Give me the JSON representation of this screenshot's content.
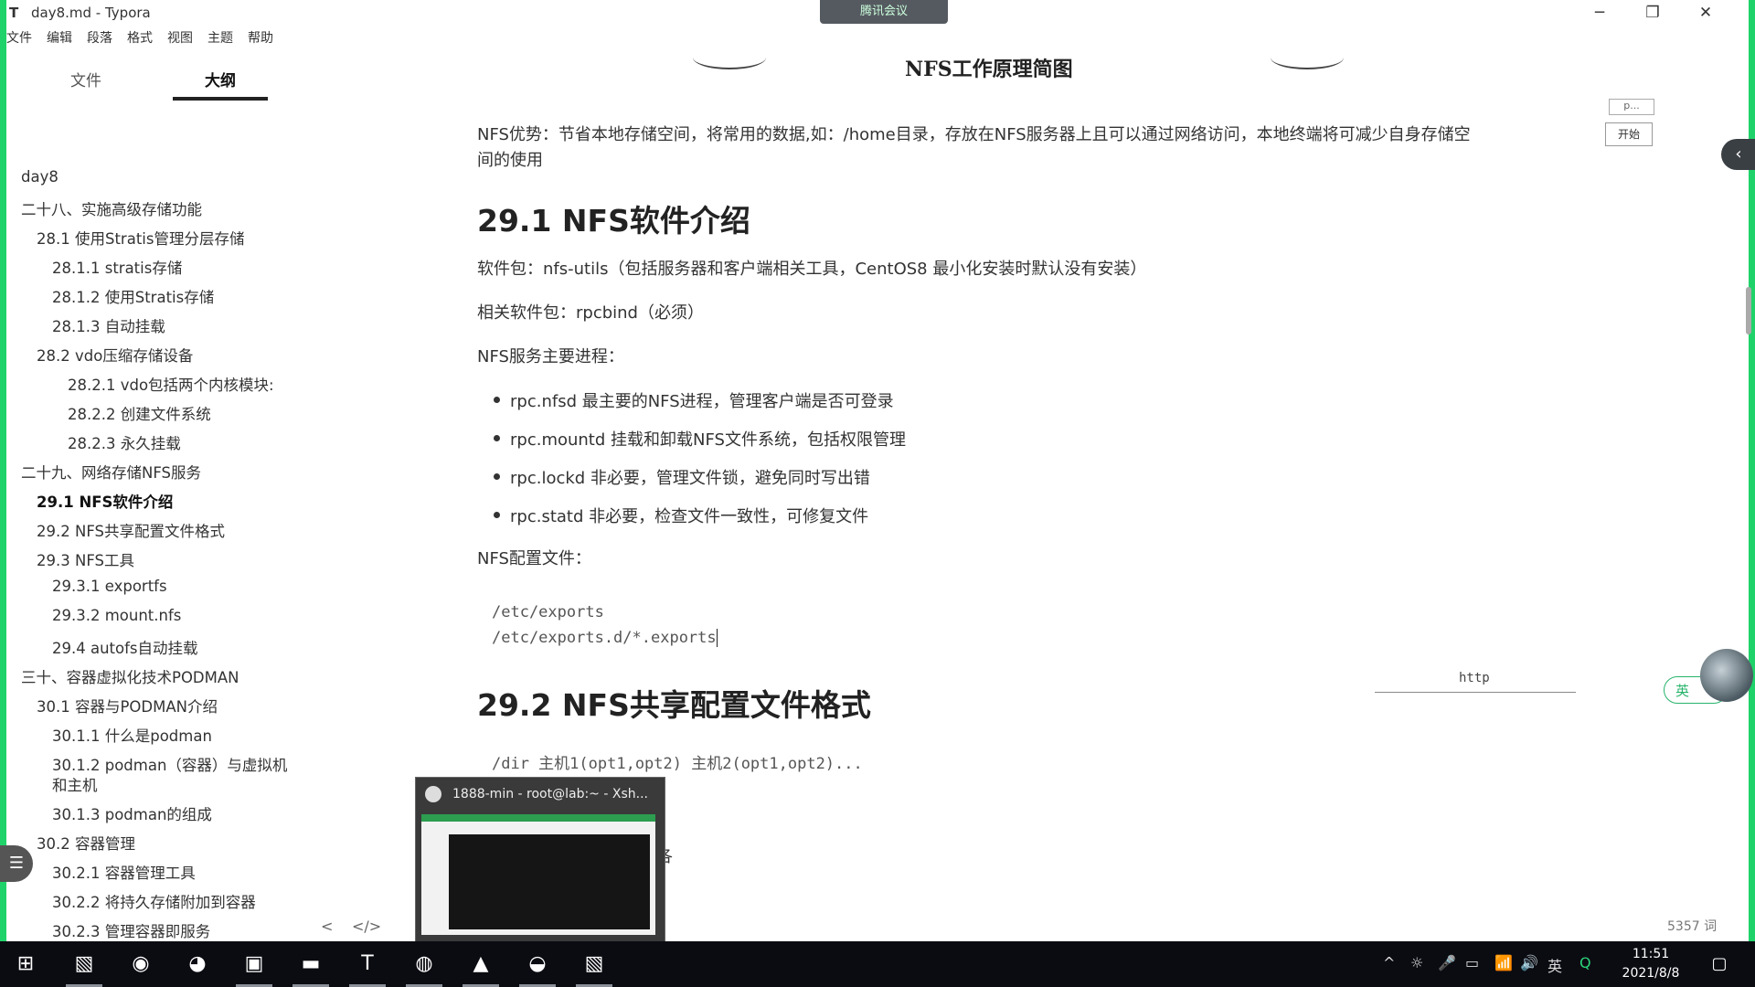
{
  "window": {
    "app_icon": "T",
    "title": "day8.md - Typora",
    "meeting": "腾讯会议",
    "controls": [
      "─",
      "❐",
      "✕"
    ]
  },
  "menu": [
    "文件",
    "编辑",
    "段落",
    "格式",
    "视图",
    "主题",
    "帮助"
  ],
  "sidebar": {
    "tabs": [
      "文件",
      "大纲"
    ],
    "outline": [
      "day8",
      "二十八、实施高级存储功能",
      "28.1 使用Stratis管理分层存储",
      "28.1.1 stratis存储",
      "28.1.2 使用Stratis存储",
      "28.1.3 自动挂载",
      "28.2 vdo压缩存储设备",
      "28.2.1 vdo包括两个内核模块:",
      "28.2.2 创建文件系统",
      "28.2.3 永久挂载",
      "二十九、网络存储NFS服务",
      "29.1 NFS软件介绍",
      "29.2 NFS共享配置文件格式",
      "29.3 NFS工具",
      "29.3.1 exportfs",
      "29.3.2 mount.nfs",
      "29.4 autofs自动挂载",
      "三十、容器虚拟化技术PODMAN",
      "30.1 容器与PODMAN介绍",
      "30.1.1 什么是podman",
      "30.1.2 podman（容器）与虚拟机",
      "和主机",
      "30.1.3 podman的组成",
      "30.2 容器管理",
      "30.2.1 容器管理工具",
      "30.2.2 将持久存储附加到容器",
      "30.2.3 管理容器即服务"
    ],
    "footer_left": "<",
    "footer_right": "</>"
  },
  "content": {
    "image_title": "NFS工作原理简图",
    "advantage_line1": "NFS优势：节省本地存储空间，将常用的数据,如：/home目录，存放在NFS服务器上且可以通过网络访问，本地终端将可减少自身存储空",
    "advantage_line2": "间的使用",
    "h_29_1": "29.1 NFS软件介绍",
    "pkg": "软件包：nfs-utils（包括服务器和客户端相关工具，CentOS8 最小化安装时默认没有安装）",
    "related_pkg": "相关软件包：rpcbind（必须）",
    "main_proc": "NFS服务主要进程：",
    "bullets": [
      "rpc.nfsd 最主要的NFS进程，管理客户端是否可登录",
      "rpc.mountd 挂载和卸载NFS文件系统，包括权限管理",
      "rpc.lockd 非必要，管理文件锁，避免同时写出错",
      "rpc.statd 非必要，检查文件一致性，可修复文件"
    ],
    "config_file": "NFS配置文件：",
    "code_lines": [
      "/etc/exports",
      "/etc/exports.d/*.exports"
    ],
    "h_29_2": "29.2 NFS共享配置文件格式",
    "format_code": "/dir 主机1(opt1,opt2) 主机2(opt1,opt2)...",
    "partial_char": "各"
  },
  "right_widgets": {
    "mini_label": "p...",
    "start_button": "开始",
    "http_label": "http",
    "lang": "英",
    "word_count": "5357 词"
  },
  "popup": {
    "title": "1888-min - root@lab:~ - Xsh..."
  },
  "taskbar": {
    "icons": [
      "windows-start-icon",
      "photo-app-icon",
      "browser-icon",
      "wechat-icon",
      "window-app-icon",
      "folder-icon",
      "typora-icon",
      "media-icon",
      "meeting-icon",
      "xshell-icon",
      "photo-app-icon-2"
    ],
    "tray": [
      "^",
      "☼",
      "🎤",
      "▭",
      "📶",
      "🔊",
      "英",
      "Q"
    ],
    "time": "11:51",
    "date": "2021/8/8"
  },
  "colors": {
    "accent_green": "#1fd36a",
    "taskbar": "#0b0c12"
  }
}
